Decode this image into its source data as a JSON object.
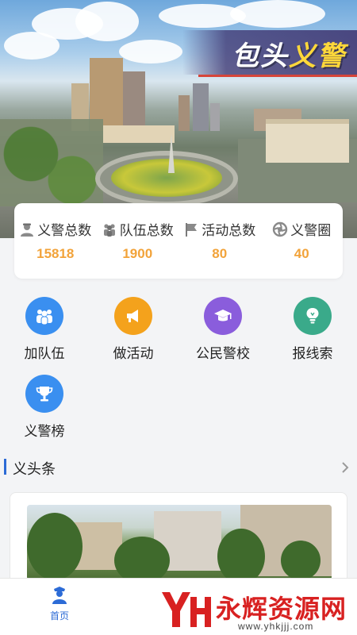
{
  "header": {
    "title_main": "包头",
    "title_accent": "义警"
  },
  "stats": [
    {
      "label": "义警总数",
      "value": "15818",
      "icon": "volunteer-police-icon"
    },
    {
      "label": "队伍总数",
      "value": "1900",
      "icon": "team-icon"
    },
    {
      "label": "活动总数",
      "value": "80",
      "icon": "flag-icon"
    },
    {
      "label": "义警圈",
      "value": "40",
      "icon": "aperture-icon"
    }
  ],
  "menu": [
    {
      "label": "加队伍",
      "icon": "team-icon",
      "color": "#3a8ff0"
    },
    {
      "label": "做活动",
      "icon": "megaphone-icon",
      "color": "#f4a21c"
    },
    {
      "label": "公民警校",
      "icon": "graduation-cap-icon",
      "color": "#8a5ddc"
    },
    {
      "label": "报线索",
      "icon": "lightbulb-icon",
      "color": "#3aaa8a"
    },
    {
      "label": "义警榜",
      "icon": "trophy-icon",
      "color": "#3a8ff0"
    }
  ],
  "headlines": {
    "title": "义头条"
  },
  "tabbar": {
    "home_label": "首页",
    "accent": "#2c6bd6"
  },
  "watermark": {
    "text": "永辉资源网",
    "url": "www.yhkjjj.com"
  }
}
